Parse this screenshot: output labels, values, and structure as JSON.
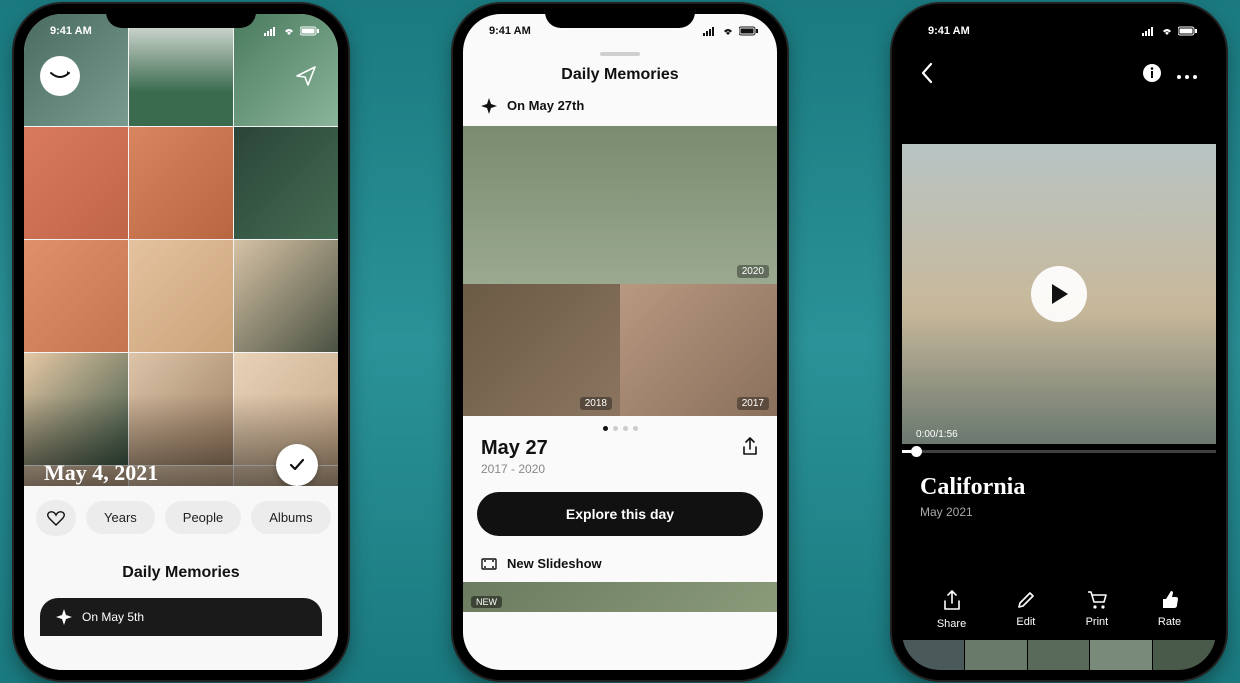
{
  "status": {
    "time": "9:41 AM"
  },
  "screen1": {
    "date_header": "May 4, 2021",
    "chips": {
      "years": "Years",
      "people": "People",
      "albums": "Albums"
    },
    "section_title": "Daily Memories",
    "next_memory": "On May 5th"
  },
  "screen2": {
    "title": "Daily Memories",
    "on_label": "On May 27th",
    "hero_year": "2020",
    "thumb_a_year": "2018",
    "thumb_b_year": "2017",
    "date": "May 27",
    "range": "2017 - 2020",
    "cta": "Explore this day",
    "slideshow": "New Slideshow",
    "new_tag": "NEW"
  },
  "screen3": {
    "time": "0:00/1:56",
    "title": "California",
    "subtitle": "May 2021",
    "actions": {
      "share": "Share",
      "edit": "Edit",
      "print": "Print",
      "rate": "Rate"
    }
  }
}
